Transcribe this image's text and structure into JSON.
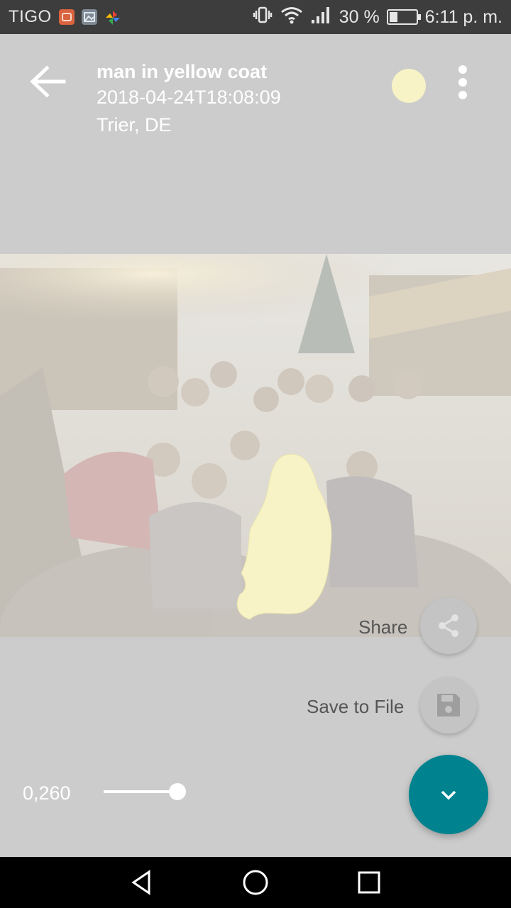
{
  "status_bar": {
    "carrier": "TIGO",
    "battery_text": "30 %",
    "battery_level": 0.3,
    "time": "6:11 p. m.",
    "icons": [
      "notification-app-icon",
      "gallery-icon",
      "pinwheel-icon",
      "vibrate-icon",
      "wifi-icon",
      "signal-icon",
      "battery-icon"
    ]
  },
  "header": {
    "back_icon": "arrow-left-icon",
    "title": "man in yellow coat",
    "timestamp": "2018-04-24T18:08:09",
    "location": "Trier, DE",
    "mask_color": "#f7f3c6",
    "more_icon": "more-vert-icon"
  },
  "actions": {
    "share_label": "Share",
    "share_icon": "share-icon",
    "save_label": "Save to File",
    "save_icon": "save-icon",
    "collapse_icon": "chevron-down-icon",
    "fab_color": "#00838f"
  },
  "threshold": {
    "value_text": "0,260",
    "level": 0.26
  },
  "navigation": {
    "icons": [
      "back-triangle-icon",
      "home-circle-icon",
      "recents-square-icon"
    ]
  }
}
